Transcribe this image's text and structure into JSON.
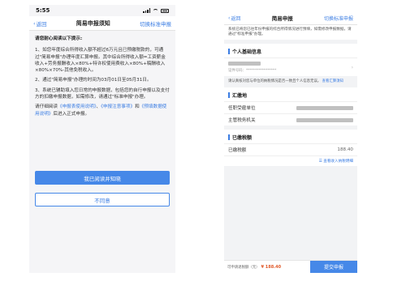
{
  "left": {
    "status_time": "5:55",
    "nav": {
      "back": "返回",
      "title": "简易申报须知",
      "right": "切换标准申报"
    },
    "heading": "请您耐心阅读以下提示:",
    "para1": "1、如您年度综合所得收入额不超过6万元且已预缴税款的，可通过\"简易申报\"办理年度汇算申报。其中综合所得收入额=工资薪金收入+劳务报酬收入×80%+特许权使用费收入×80%+稿酬收入×80%×70%-其他免税收入。",
    "para2": "2、通过\"简易申报\"办理的时间为03月01日至05月31日。",
    "para3": "3、系统已辅助填入您日常的申报数据，包括您的自行申报以及支付方的扣缴申报数据，如需修改，请通过\"标准申报\"办理。",
    "para4_prefix": "请仔细阅读",
    "para4_link1": "《申报表使用说明》",
    "para4_sep": "、",
    "para4_link2": "《申报注意事项》",
    "para4_mid": "和",
    "para4_link3": "《预填数据使用说明》",
    "para4_suffix": "后进入正式申报。",
    "btn_agree": "我已阅读并知晓",
    "btn_disagree": "不同意"
  },
  "right": {
    "nav": {
      "back": "返回",
      "title": "简易申报",
      "right": "切换标准申报"
    },
    "tip_top": "系统已将您已往年份申报的综合所得情况进行预填，如需修改申报数据，请通过\"标准申报\"办理。",
    "section_personal": "个人基础信息",
    "id_label": "证件号码：",
    "id_masked": "*****************",
    "tip_mid_text": "请认真核对您与单位的纳税情况是否一致且个人信息无误。",
    "tip_mid_link": "查看汇算须知",
    "section_collect": "汇缴地",
    "row_employer": "任职受雇单位",
    "row_tax_office": "主管税务机关",
    "section_paid": "已缴税额",
    "row_paid_label": "已缴税额",
    "row_paid_value": "188.40",
    "link_detail": "查看收入纳税明细",
    "bottom_label": "可申请退税额（元）",
    "bottom_amount": "¥ 188.40",
    "bottom_submit": "提交申报"
  },
  "colors": {
    "accent": "#4688e8",
    "link": "#3b7de3",
    "refund": "#e05a2b"
  }
}
